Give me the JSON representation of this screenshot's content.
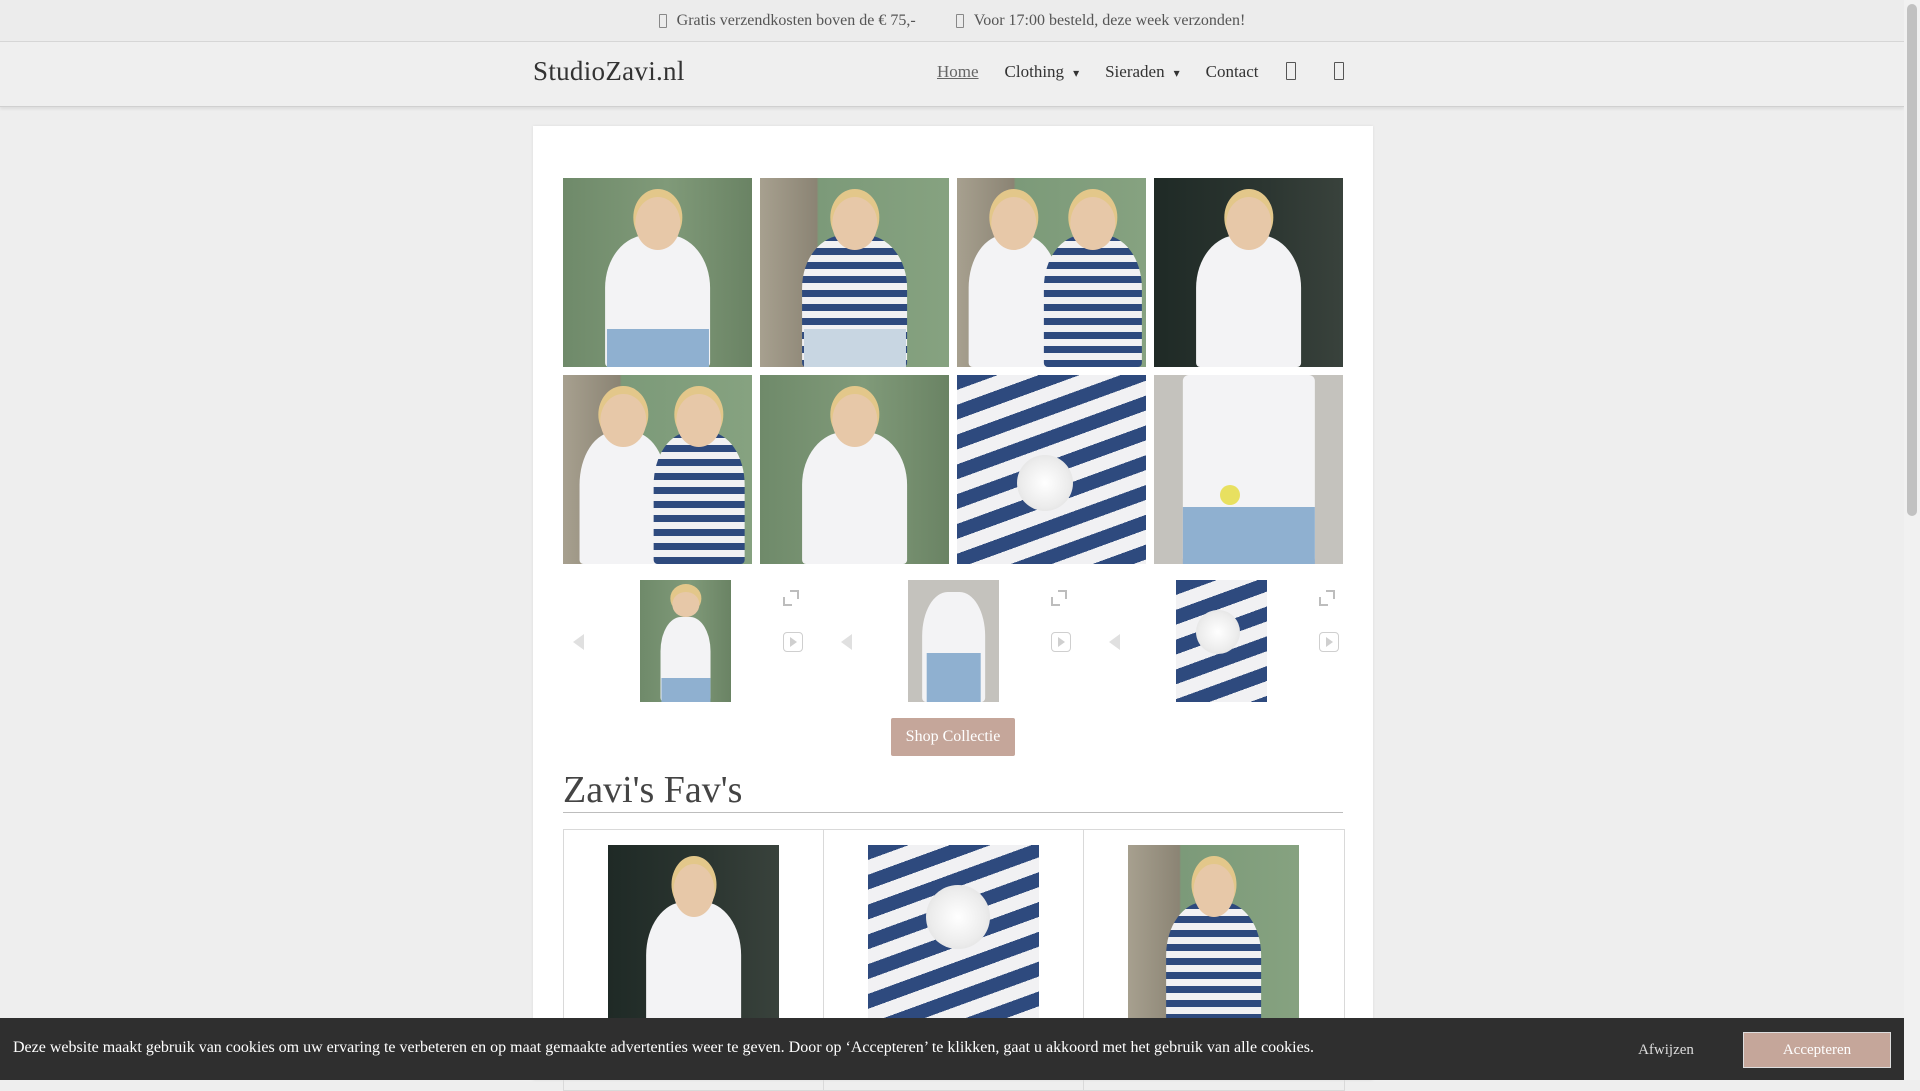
{
  "topbar": {
    "usp1": "Gratis verzendkosten boven de € 75,-",
    "usp2": "Voor 17:00 besteld, deze week verzonden!"
  },
  "header": {
    "logo": "StudioZavi.nl",
    "nav": {
      "home": "Home",
      "clothing": "Clothing",
      "sieraden": "Sieraden",
      "contact": "Contact"
    },
    "caret": "▾"
  },
  "main": {
    "shop_button": "Shop Collectie",
    "favs_title": "Zavi's Fav's"
  },
  "cookie": {
    "message": "Deze website maakt gebruik van cookies om uw ervaring te verbeteren en op maat gemaakte advertenties weer te geven. Door op ‘Accepteren’ te klikken, gaat u akkoord met het gebruik van alle cookies.",
    "decline": "Afwijzen",
    "accept": "Accepteren"
  },
  "icons": {
    "usp": "info-icon",
    "account": "user-icon",
    "cart": "cart-icon"
  },
  "colors": {
    "accent": "#c5a69a",
    "cookie_bar": "#2f2f2f"
  }
}
